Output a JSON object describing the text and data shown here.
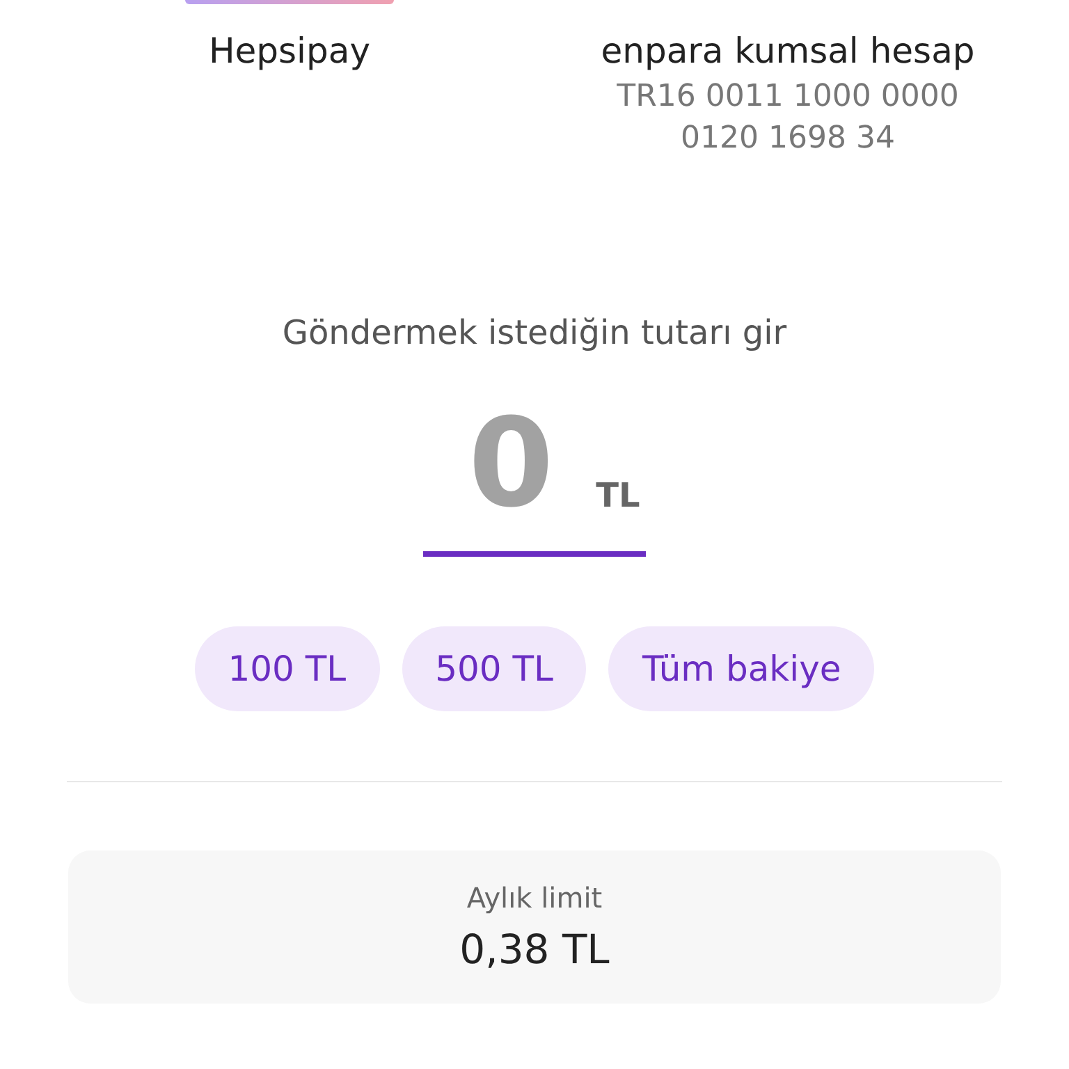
{
  "sender": {
    "name": "Hepsipay"
  },
  "receiver": {
    "name": "enpara kumsal hesap",
    "iban": "TR16 0011 1000 0000 0120 1698 34"
  },
  "amount": {
    "prompt": "Göndermek istediğin tutarı gir",
    "placeholder": "0",
    "currency": "TL"
  },
  "quick_amounts": [
    "100 TL",
    "500 TL",
    "Tüm bakiye"
  ],
  "limit": {
    "label": "Aylık limit",
    "value": "0,38 TL"
  }
}
